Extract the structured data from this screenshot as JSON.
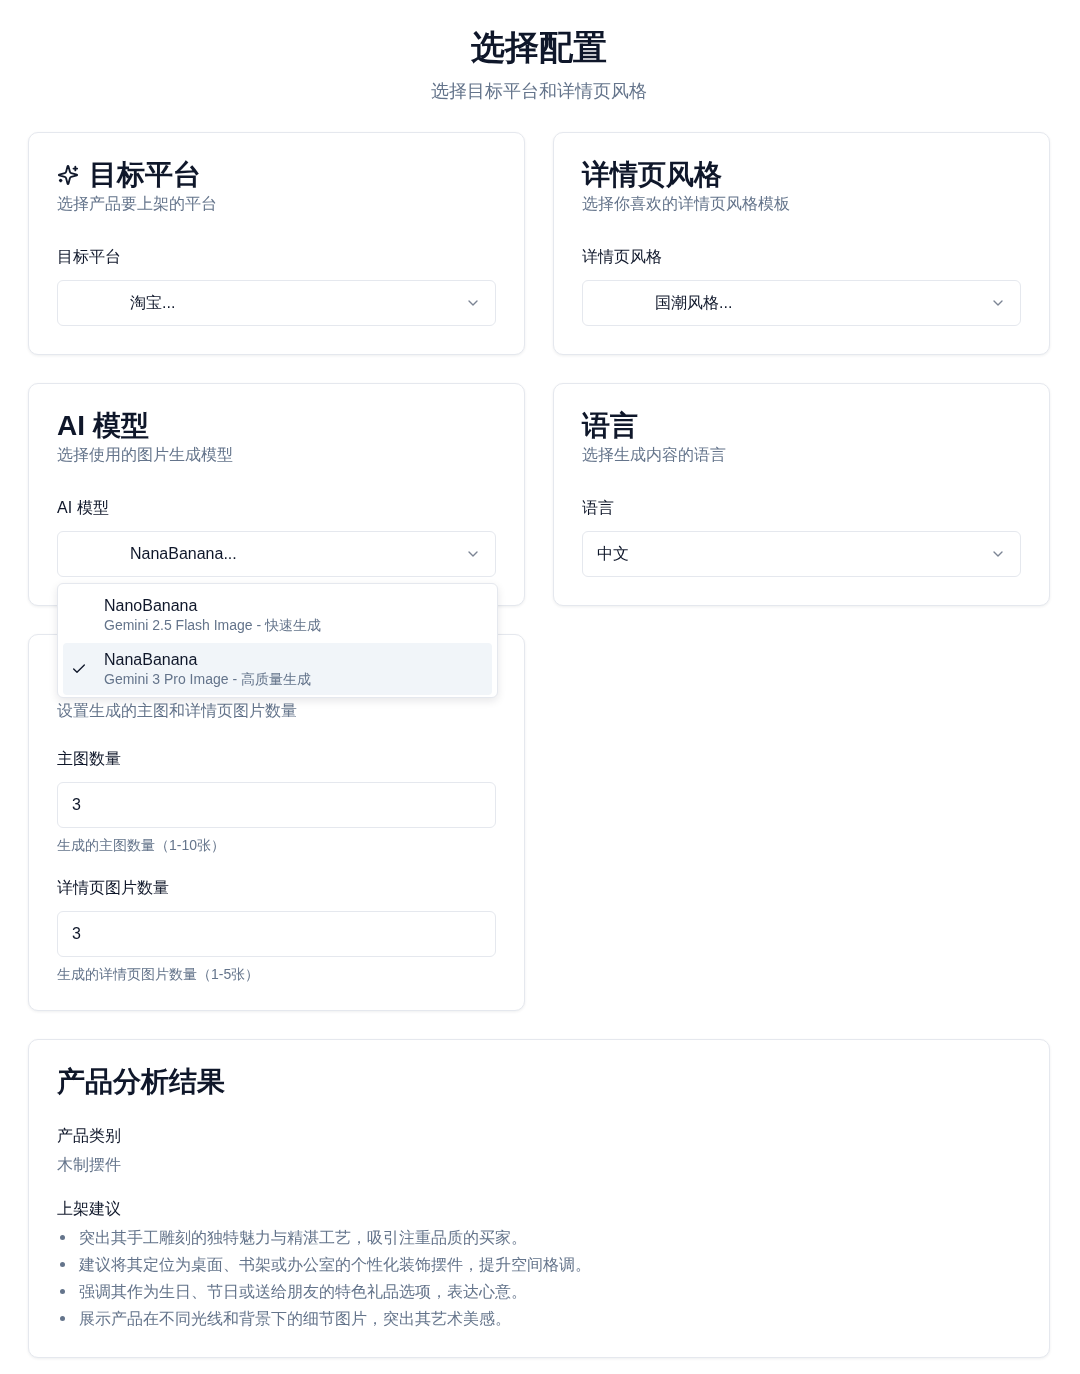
{
  "header": {
    "title": "选择配置",
    "subtitle": "选择目标平台和详情页风格"
  },
  "config_cards": [
    {
      "kind": "select",
      "icon": true,
      "title": "目标平台",
      "description": "选择产品要上架的平台",
      "field": {
        "label": "目标平台",
        "value": "淘宝...",
        "kind": "preview",
        "expanded": false
      }
    },
    {
      "kind": "select",
      "icon": false,
      "title": "详情页风格",
      "description": "选择你喜欢的详情页风格模板",
      "field": {
        "label": "详情页风格",
        "value": "国潮风格...",
        "kind": "preview",
        "expanded": false
      }
    },
    {
      "kind": "select",
      "icon": false,
      "title": "AI 模型",
      "description": "选择使用的图片生成模型",
      "field": {
        "label": "AI 模型",
        "value": "NanaBanana...",
        "kind": "preview",
        "expanded": true,
        "options": [
          {
            "name": "NanoBanana",
            "detail": "Gemini 2.5 Flash Image - 快速生成",
            "selected": false
          },
          {
            "name": "NanaBanana",
            "detail": "Gemini 3 Pro Image - 高质量生成",
            "selected": true
          }
        ]
      }
    },
    {
      "kind": "select",
      "icon": false,
      "title": "语言",
      "description": "选择生成内容的语言",
      "field": {
        "label": "语言",
        "value": "中文",
        "kind": "plain",
        "expanded": false
      }
    },
    {
      "kind": "number_inputs",
      "description": "设置生成的主图和详情页图片数量",
      "fields": [
        {
          "label": "主图数量",
          "value": "3",
          "hint": "生成的主图数量（1-10张）"
        },
        {
          "label": "详情页图片数量",
          "value": "3",
          "hint": "生成的详情页图片数量（1-5张）"
        }
      ]
    }
  ],
  "analysis": {
    "title": "产品分析结果",
    "sections": [
      {
        "kind": "text",
        "label": "产品类别",
        "value": "木制摆件"
      },
      {
        "kind": "list",
        "label": "上架建议",
        "items": [
          "突出其手工雕刻的独特魅力与精湛工艺，吸引注重品质的买家。",
          "建议将其定位为桌面、书架或办公室的个性化装饰摆件，提升空间格调。",
          "强调其作为生日、节日或送给朋友的特色礼品选项，表达心意。",
          "展示产品在不同光线和背景下的细节图片，突出其艺术美感。"
        ]
      }
    ]
  }
}
